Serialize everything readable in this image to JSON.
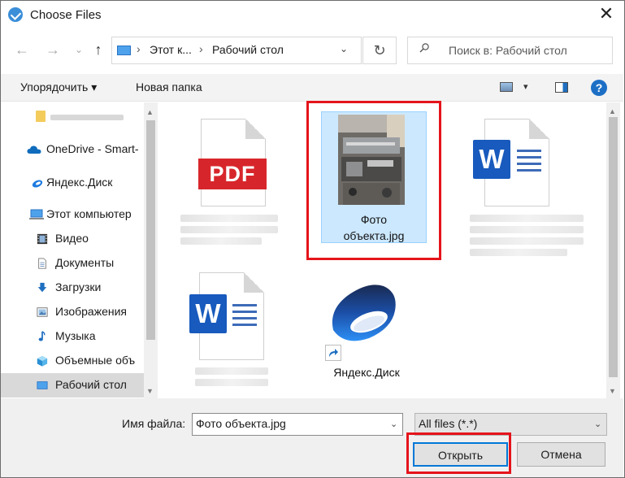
{
  "window": {
    "title": "Choose Files",
    "close_glyph": "✕"
  },
  "nav": {
    "back_glyph": "←",
    "forward_glyph": "→",
    "recent_glyph": "⌄",
    "up_glyph": "↑"
  },
  "address": {
    "crumbs": [
      "Этот к...",
      "Рабочий стол"
    ],
    "separator": "›",
    "dropdown_glyph": "⌄",
    "refresh_glyph": "↻"
  },
  "search": {
    "placeholder": "Поиск в: Рабочий стол"
  },
  "toolbar": {
    "organize_label": "Упорядочить ▾",
    "new_folder_label": "Новая папка",
    "view_drop_glyph": "▾",
    "help_label": "?"
  },
  "sidebar": {
    "items": [
      {
        "label": "",
        "icon": "folder-icon"
      },
      {
        "label": "OneDrive - Smart-",
        "icon": "onedrive-icon"
      },
      {
        "label": "Яндекс.Диск",
        "icon": "yandex-disk-icon"
      },
      {
        "label": "Этот компьютер",
        "icon": "computer-icon"
      },
      {
        "label": "Видео",
        "icon": "video-icon"
      },
      {
        "label": "Документы",
        "icon": "documents-icon"
      },
      {
        "label": "Загрузки",
        "icon": "downloads-icon"
      },
      {
        "label": "Изображения",
        "icon": "pictures-icon"
      },
      {
        "label": "Музыка",
        "icon": "music-icon"
      },
      {
        "label": "Объемные объ",
        "icon": "3d-objects-icon"
      },
      {
        "label": "Рабочий стол",
        "icon": "desktop-icon"
      }
    ],
    "selected_index": 10
  },
  "files": {
    "items": [
      {
        "name": "",
        "type": "pdf",
        "badge": "PDF"
      },
      {
        "name": "Фото объекта.jpg",
        "type": "jpg",
        "selected": true
      },
      {
        "name": "",
        "type": "docx",
        "badge": "W"
      },
      {
        "name": "",
        "type": "docx",
        "badge": "W"
      },
      {
        "name": "Яндекс.Диск",
        "type": "shortcut"
      }
    ],
    "photo_caption_lines": [
      "Фото",
      "объекта.jpg"
    ]
  },
  "footer": {
    "filename_label": "Имя файла:",
    "filename_value": "Фото объекта.jpg",
    "filter_value": "All files (*.*)",
    "open_label": "Открыть",
    "cancel_label": "Отмена",
    "drop_glyph": "⌄"
  },
  "colors": {
    "highlight": "#e5141b",
    "selection": "#cce8ff",
    "accent": "#0078d7"
  }
}
